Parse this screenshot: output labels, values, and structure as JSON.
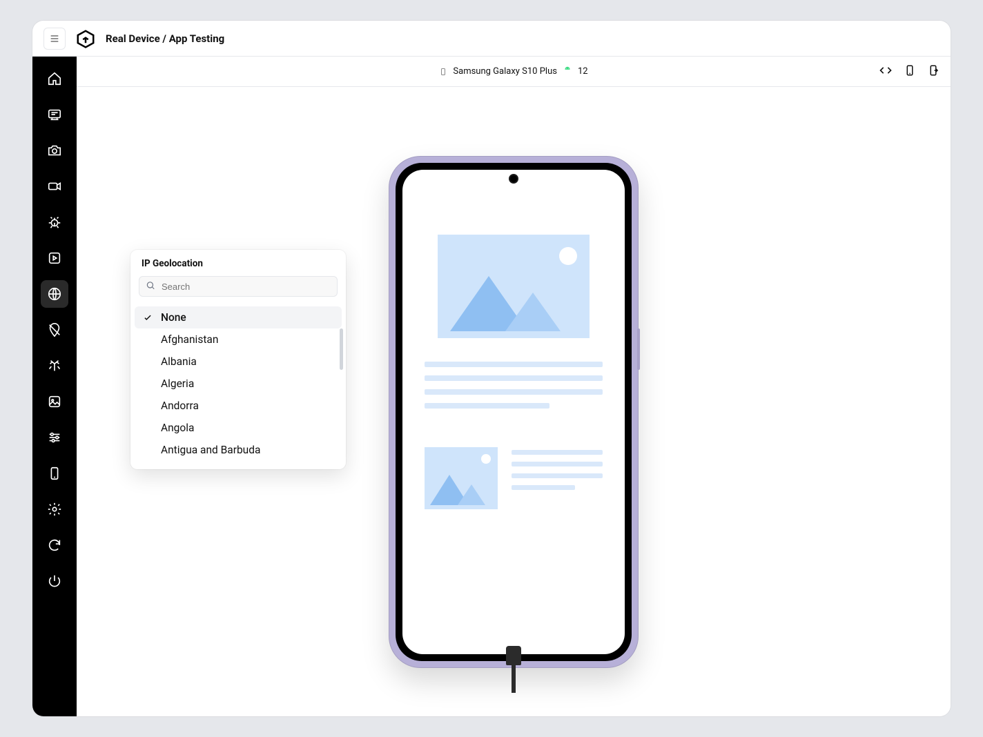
{
  "header": {
    "title": "Real Device / App Testing"
  },
  "deviceBar": {
    "deviceName": "Samsung Galaxy S10 Plus",
    "osVersion": "12"
  },
  "popover": {
    "title": "IP Geolocation",
    "searchPlaceholder": "Search",
    "options": [
      {
        "label": "None",
        "selected": true
      },
      {
        "label": "Afghanistan",
        "selected": false
      },
      {
        "label": "Albania",
        "selected": false
      },
      {
        "label": "Algeria",
        "selected": false
      },
      {
        "label": "Andorra",
        "selected": false
      },
      {
        "label": "Angola",
        "selected": false
      },
      {
        "label": "Antigua and Barbuda",
        "selected": false
      }
    ]
  },
  "sidebar": {
    "items": [
      {
        "name": "home"
      },
      {
        "name": "app"
      },
      {
        "name": "camera"
      },
      {
        "name": "video"
      },
      {
        "name": "bug"
      },
      {
        "name": "play"
      },
      {
        "name": "globe"
      },
      {
        "name": "location-off"
      },
      {
        "name": "network"
      },
      {
        "name": "image"
      },
      {
        "name": "sliders"
      },
      {
        "name": "device"
      },
      {
        "name": "settings"
      },
      {
        "name": "refresh"
      },
      {
        "name": "power"
      }
    ],
    "activeIndex": 6
  }
}
